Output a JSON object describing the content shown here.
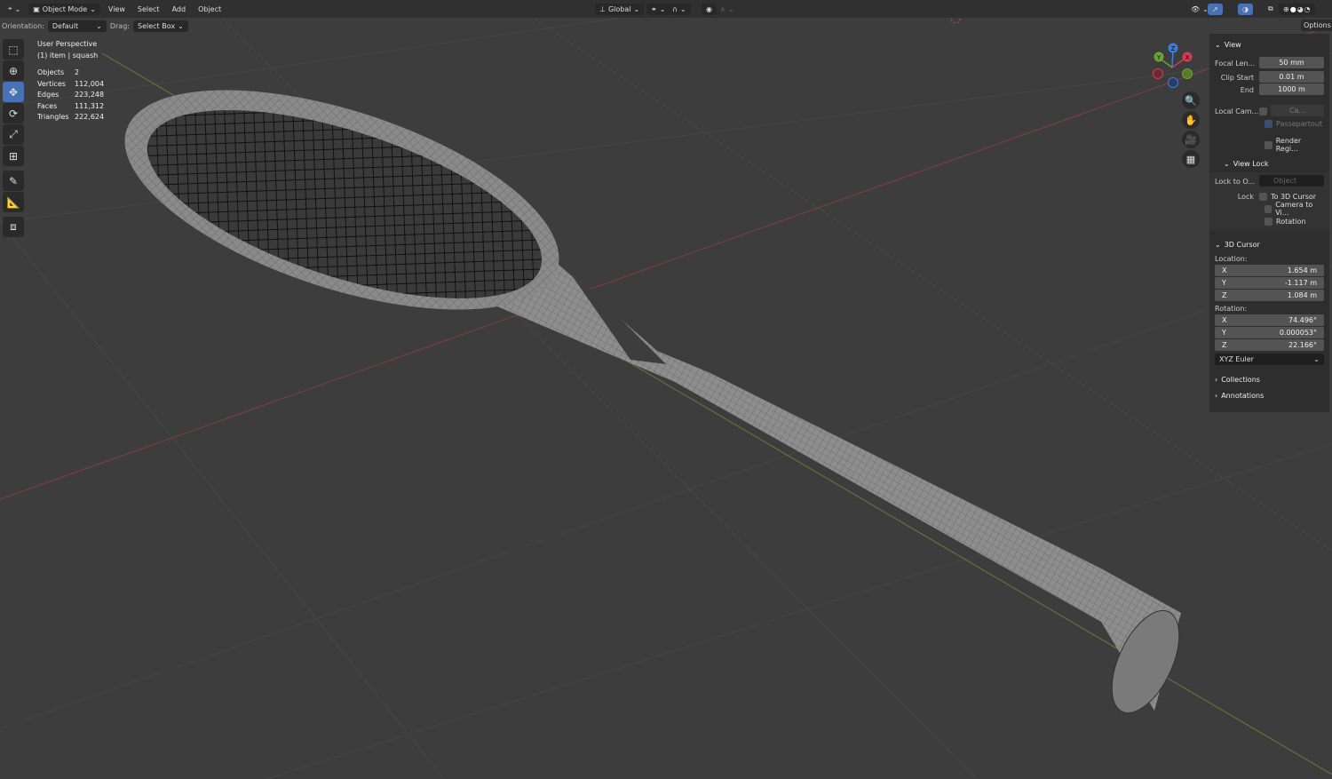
{
  "header": {
    "mode": "Object Mode",
    "menus": [
      "View",
      "Select",
      "Add",
      "Object"
    ],
    "transform_orientation": "Global"
  },
  "toolbar": {
    "orientation_label": "Orientation:",
    "orientation_value": "Default",
    "drag_label": "Drag:",
    "drag_value": "Select Box",
    "options_label": "Options"
  },
  "viewport_info": {
    "perspective": "User Perspective",
    "selection": "(1) item | squash",
    "stats": [
      {
        "label": "Objects",
        "value": "2"
      },
      {
        "label": "Vertices",
        "value": "112,004"
      },
      {
        "label": "Edges",
        "value": "223,248"
      },
      {
        "label": "Faces",
        "value": "111,312"
      },
      {
        "label": "Triangles",
        "value": "222,624"
      }
    ]
  },
  "tools": [
    "select-box",
    "cursor",
    "move",
    "rotate",
    "scale",
    "transform",
    "annotate",
    "measure",
    "add-cube"
  ],
  "gizmo": {
    "x": "X",
    "y": "Y",
    "z": "Z",
    "x_color": "#d63a4f",
    "y_color": "#6ca238",
    "z_color": "#3c7de0"
  },
  "sidebar": {
    "view": {
      "title": "View",
      "focal_label": "Focal Len...",
      "focal": "50 mm",
      "clip_start_label": "Clip Start",
      "clip_start": "0.01 m",
      "end_label": "End",
      "end": "1000 m",
      "local_cam_label": "Local Cam...",
      "local_cam_value": "Ca...",
      "passepartout": "Passepartout",
      "render_region": "Render Regi..."
    },
    "view_lock": {
      "title": "View Lock",
      "lock_to_label": "Lock to O...",
      "lock_to_placeholder": "Object",
      "lock_label": "Lock",
      "to_cursor": "To 3D Cursor",
      "camera_to_view": "Camera to Vi...",
      "rotation": "Rotation"
    },
    "cursor": {
      "title": "3D Cursor",
      "location_label": "Location:",
      "location": [
        {
          "axis": "X",
          "value": "1.654 m"
        },
        {
          "axis": "Y",
          "value": "-1.117 m"
        },
        {
          "axis": "Z",
          "value": "1.084 m"
        }
      ],
      "rotation_label": "Rotation:",
      "rotation": [
        {
          "axis": "X",
          "value": "74.496°"
        },
        {
          "axis": "Y",
          "value": "0.000053°"
        },
        {
          "axis": "Z",
          "value": "22.166°"
        }
      ],
      "rotation_mode": "XYZ Euler"
    },
    "collections": "Collections",
    "annotations": "Annotations"
  }
}
